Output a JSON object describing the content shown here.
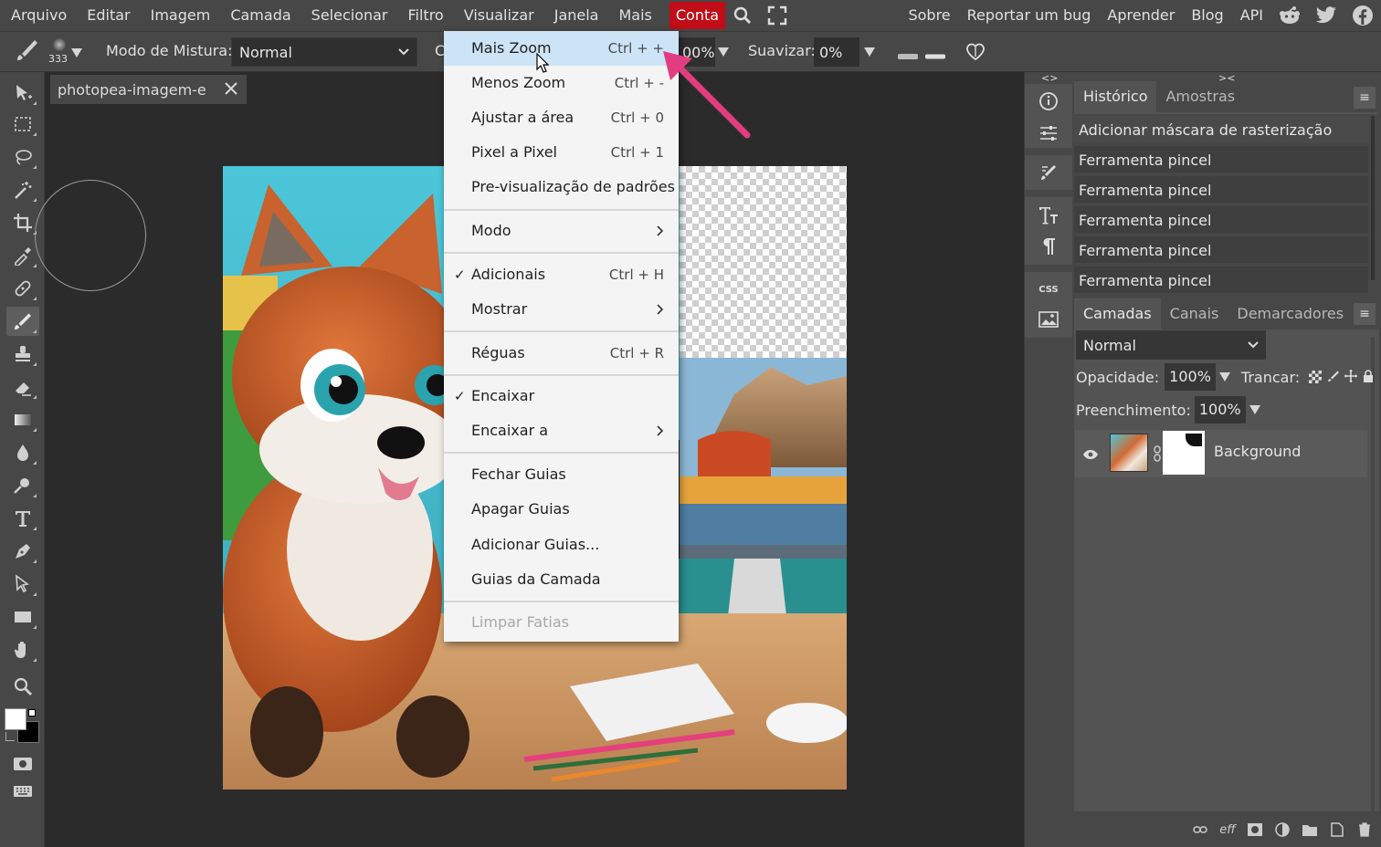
{
  "menubar": {
    "items": [
      "Arquivo",
      "Editar",
      "Imagem",
      "Camada",
      "Selecionar",
      "Filtro",
      "Visualizar",
      "Janela",
      "Mais"
    ],
    "account": "Conta",
    "right_links": [
      "Sobre",
      "Reportar um bug",
      "Aprender",
      "Blog",
      "API"
    ],
    "icons": [
      "search-icon",
      "fullscreen-icon",
      "reddit-icon",
      "twitter-icon",
      "facebook-icon"
    ],
    "accent": "#c10d17"
  },
  "options": {
    "brush_size": "333",
    "blend_label": "Modo de Mistura:",
    "blend_value": "Normal",
    "partial_label": "C",
    "flow_value": "00%",
    "smooth_label": "Suavizar:",
    "smooth_value": "0%"
  },
  "document": {
    "tab_title": "photopea-imagem-e *"
  },
  "view_menu": {
    "items": [
      {
        "label": "Mais Zoom",
        "shortcut": "Ctrl + +"
      },
      {
        "label": "Menos Zoom",
        "shortcut": "Ctrl + -"
      },
      {
        "label": "Ajustar a área",
        "shortcut": "Ctrl + 0"
      },
      {
        "label": "Pixel a Pixel",
        "shortcut": "Ctrl + 1"
      },
      {
        "label": "Pre-visualização de padrões",
        "shortcut": ""
      },
      {
        "label": "Modo",
        "shortcut": ""
      },
      {
        "label": "Adicionais",
        "shortcut": "Ctrl + H"
      },
      {
        "label": "Mostrar",
        "shortcut": ""
      },
      {
        "label": "Réguas",
        "shortcut": "Ctrl + R"
      },
      {
        "label": "Encaixar",
        "shortcut": ""
      },
      {
        "label": "Encaixar a",
        "shortcut": ""
      },
      {
        "label": "Fechar Guias",
        "shortcut": ""
      },
      {
        "label": "Apagar Guias",
        "shortcut": ""
      },
      {
        "label": "Adicionar Guias...",
        "shortcut": ""
      },
      {
        "label": "Guias da Camada",
        "shortcut": ""
      },
      {
        "label": "Limpar Fatias",
        "shortcut": ""
      }
    ],
    "checked": [
      "Adicionais",
      "Encaixar"
    ],
    "submenus": [
      "Modo",
      "Mostrar",
      "Encaixar a"
    ],
    "disabled": [
      "Limpar Fatias"
    ],
    "hovered": "Mais Zoom"
  },
  "history_panel": {
    "tabs": [
      "Histórico",
      "Amostras"
    ],
    "rows": [
      "Adicionar máscara de rasterização",
      "Ferramenta pincel",
      "Ferramenta pincel",
      "Ferramenta pincel",
      "Ferramenta pincel",
      "Ferramenta pincel"
    ]
  },
  "layers_panel": {
    "tabs": [
      "Camadas",
      "Canais",
      "Demarcadores"
    ],
    "blend_mode": "Normal",
    "opacity_label": "Opacidade:",
    "opacity_value": "100%",
    "lock_label": "Trancar:",
    "fill_label": "Preenchimento:",
    "fill_value": "100%",
    "layer_name": "Background",
    "footer_icons": [
      "link-icon",
      "effects-icon",
      "mask-icon",
      "adjustment-icon",
      "folder-icon",
      "new-layer-icon",
      "trash-icon"
    ]
  }
}
